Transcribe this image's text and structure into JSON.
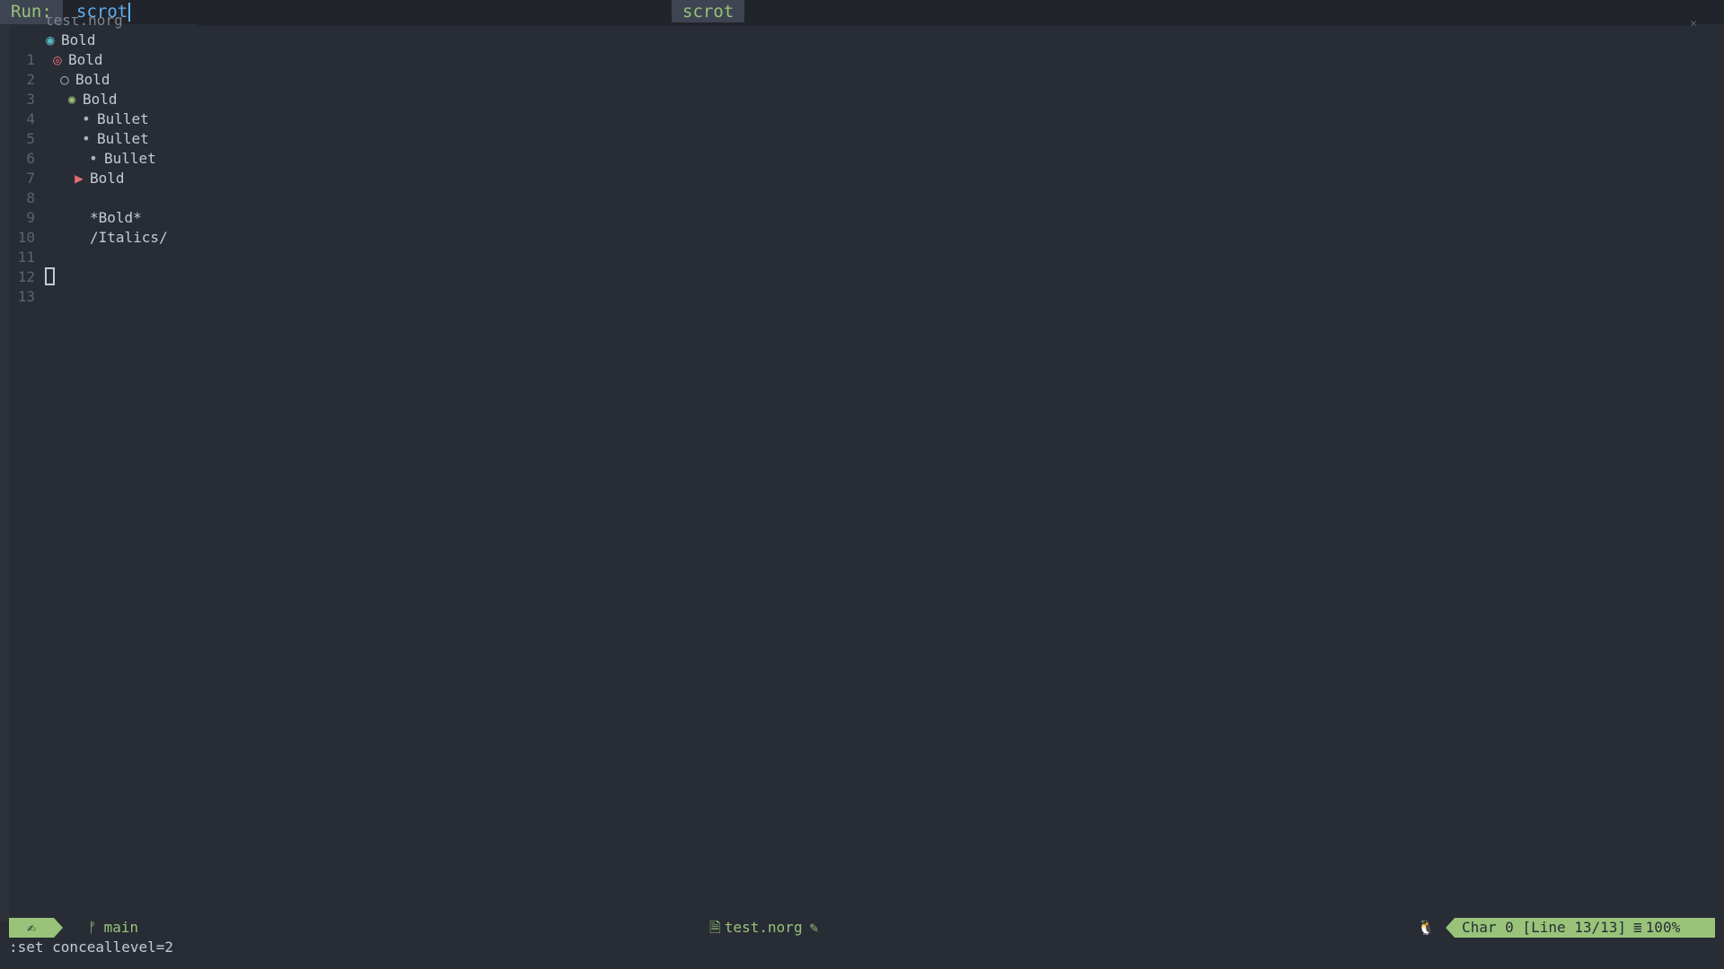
{
  "runbar": {
    "label": "Run:",
    "input_value": "scrot",
    "suggestion": "scrot"
  },
  "winbar": {
    "tab": "test.norg"
  },
  "lines": [
    {
      "num": "1",
      "marker": "◉",
      "text": "Bold"
    },
    {
      "num": "2",
      "marker": "◎",
      "text": "Bold"
    },
    {
      "num": "3",
      "marker": "○",
      "text": "Bold"
    },
    {
      "num": "4",
      "marker": "✺",
      "text": "Bold"
    },
    {
      "num": "5",
      "marker": "•",
      "text": "Bullet"
    },
    {
      "num": "6",
      "marker": "•",
      "text": "Bullet"
    },
    {
      "num": "7",
      "marker": "•",
      "text": "Bullet"
    },
    {
      "num": "8",
      "marker": "▶",
      "text": "Bold"
    },
    {
      "num": "9",
      "marker": "",
      "text": ""
    },
    {
      "num": "10",
      "marker": "",
      "text": "*Bold*"
    },
    {
      "num": "11",
      "marker": "",
      "text": "/Italics/"
    },
    {
      "num": "12",
      "marker": "",
      "text": ""
    },
    {
      "num": "13",
      "marker": "",
      "text": ""
    }
  ],
  "statusline": {
    "mode_icon": "✍",
    "branch_icon": "ᚠ",
    "branch": "main",
    "file_icon": "🗎",
    "filename": "test.norg",
    "edit_icon": "✎",
    "os_icon": "🐧",
    "position": "Char 0 [Line 13/13]",
    "progress_icon": "≣",
    "percent": "100%"
  },
  "cmdline": {
    "text": ":set conceallevel=2"
  },
  "colors": {
    "background": "#282c34",
    "accent_green": "#98c379",
    "accent_blue": "#61afef",
    "accent_red": "#e06c75",
    "accent_cyan": "#56b6c2"
  }
}
